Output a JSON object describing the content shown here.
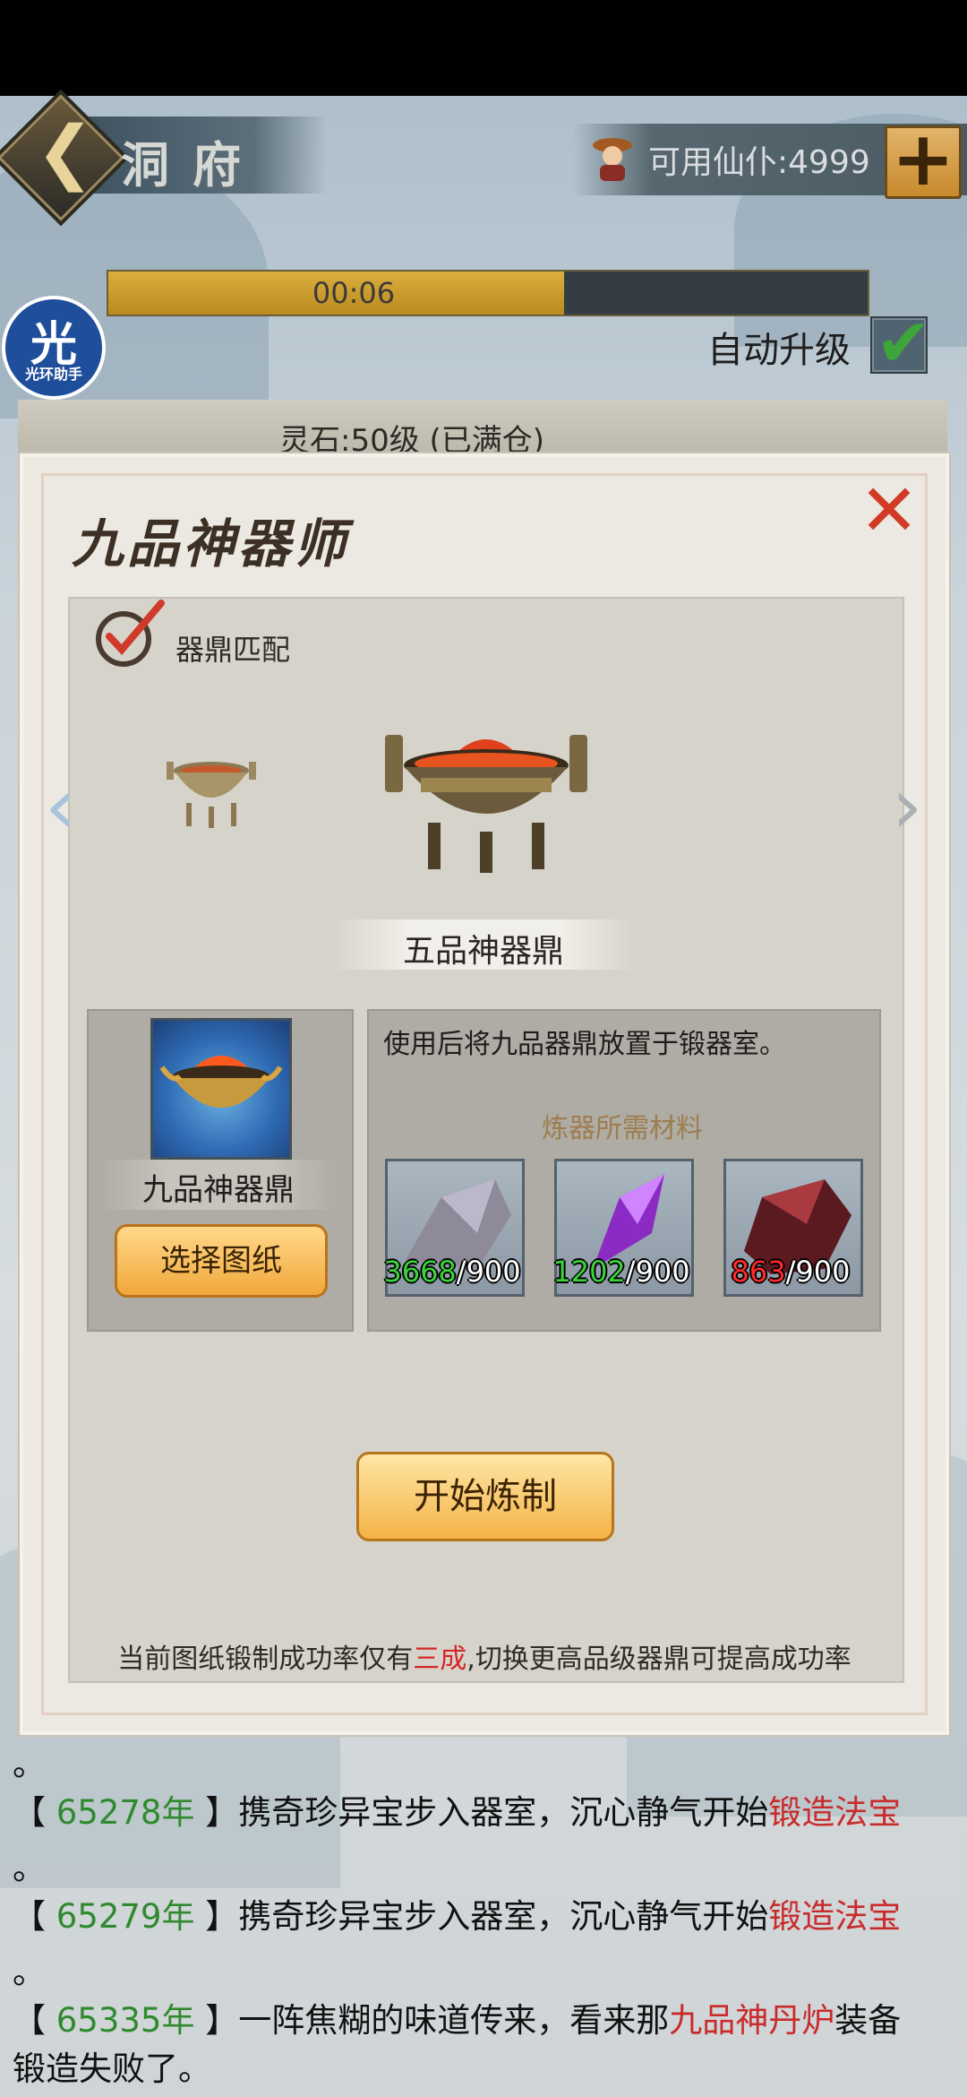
{
  "header": {
    "title": "洞府",
    "servant_label": "可用仙仆:4999",
    "add_label": "+"
  },
  "timer": {
    "text": "00:06",
    "progress": 0.6
  },
  "guanghuan": {
    "char": "光",
    "sub": "光环助手"
  },
  "auto_upgrade": {
    "label": "自动升级",
    "checked": true
  },
  "stone": {
    "text": "灵石:50级 (已满仓)"
  },
  "panel": {
    "title": "九品神器师",
    "close": "✕",
    "match_label": "器鼎匹配",
    "arrow_left": "‹",
    "arrow_right": "›",
    "cauldron_name": "五品神器鼎",
    "blueprint_name": "九品神器鼎",
    "choose_label": "选择图纸",
    "use_desc": "使用后将九品器鼎放置于锻器室。",
    "materials_title": "炼器所需材料",
    "materials": [
      {
        "name": "gray-ore",
        "have": "3668",
        "need": "/900",
        "enough": true
      },
      {
        "name": "purple-crystal",
        "have": "1202",
        "need": "/900",
        "enough": true
      },
      {
        "name": "red-ore",
        "have": "863",
        "need": "/900",
        "enough": false
      }
    ],
    "start_label": "开始炼制",
    "rate_note_pre": "当前图纸锻制成功率仅有",
    "rate_note_red": "三成",
    "rate_note_post": ",切换更高品级器鼎可提高成功率"
  },
  "log": {
    "lines": [
      {
        "prefix": "。"
      },
      {
        "open": "【 ",
        "year": "65278年",
        "close": " 】",
        "text": "携奇珍异宝步入器室，沉心静气开始",
        "red": "锻造法宝"
      },
      {
        "prefix": "。"
      },
      {
        "open": "【 ",
        "year": "65279年",
        "close": " 】",
        "text": "携奇珍异宝步入器室，沉心静气开始",
        "red": "锻造法宝"
      },
      {
        "prefix": "。"
      },
      {
        "open": "【 ",
        "year": "65335年",
        "close": " 】",
        "text": "一阵焦糊的味道传来，看来那",
        "red": "九品神丹炉",
        "text2": "装备"
      },
      {
        "prefix": "锻造失败了。"
      }
    ]
  },
  "colors": {
    "gold": "#f1a83a",
    "red": "#d52727",
    "green": "#2f8a2f"
  }
}
